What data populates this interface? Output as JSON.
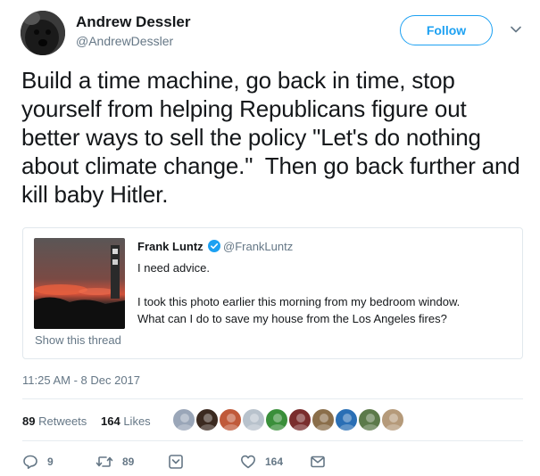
{
  "author": {
    "name": "Andrew Dessler",
    "handle": "@AndrewDessler",
    "follow_label": "Follow"
  },
  "tweet": {
    "text": "Build a time machine, go back in time, stop yourself from helping Republicans figure out better ways to sell the policy \"Let's do nothing about climate change.\"  Then go back further and kill baby Hitler.",
    "timestamp": "11:25 AM - 8 Dec 2017"
  },
  "quoted": {
    "name": "Frank Luntz",
    "handle": "@FrankLuntz",
    "text": "I need advice.\n\nI took this photo earlier this morning from my bedroom window.\nWhat can I do to save my house from the Los Angeles fires?",
    "thread_label": "Show this thread"
  },
  "stats": {
    "retweets_count": "89",
    "retweets_label": "Retweets",
    "likes_count": "164",
    "likes_label": "Likes",
    "liker_avatar_colors": [
      "#9aa6b8",
      "#3b2a20",
      "#c05a3a",
      "#b8c2cc",
      "#3a8f3a",
      "#7a2d2d",
      "#8a6e4a",
      "#2a6fb5",
      "#5c7a4a",
      "#b59a7a"
    ]
  },
  "actions": {
    "reply_count": "9",
    "retweet_count": "89",
    "like_count": "164"
  },
  "colors": {
    "accent": "#1da1f2",
    "muted": "#657786",
    "text": "#14171a",
    "border": "#e1e8ed"
  }
}
